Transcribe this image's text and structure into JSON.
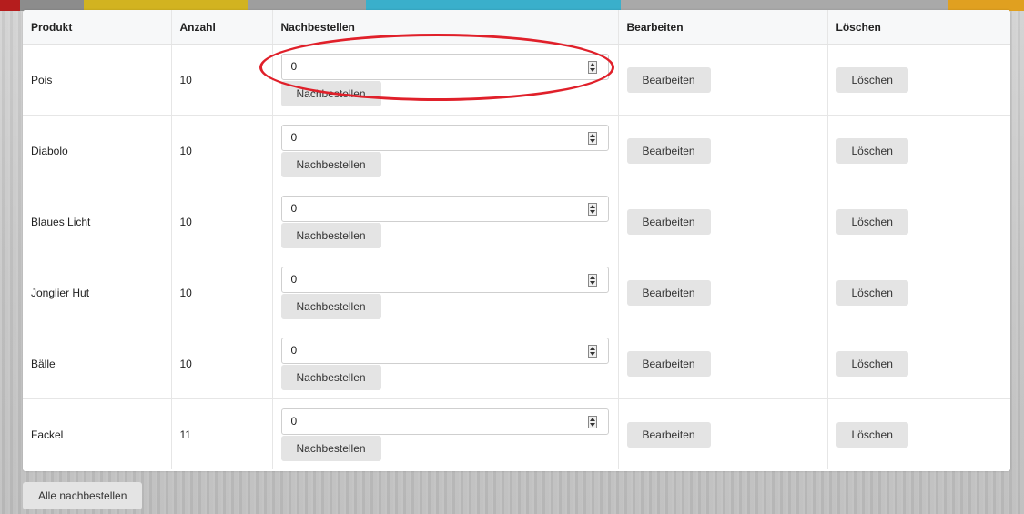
{
  "colors": {
    "strip": [
      "#b51d1d",
      "#c9a51a",
      "#d8c623",
      "#2fa8c4",
      "#38b2cf",
      "#8a8a8a",
      "#9a9a9a",
      "#e0a020"
    ],
    "annotation": "#e0202a"
  },
  "table": {
    "headers": [
      "Produkt",
      "Anzahl",
      "Nachbestellen",
      "Bearbeiten",
      "Löschen"
    ],
    "rows": [
      {
        "produkt": "Pois",
        "anzahl": "10",
        "value": "0",
        "reorder": "Nachbestellen",
        "edit": "Bearbeiten",
        "delete": "Löschen"
      },
      {
        "produkt": "Diabolo",
        "anzahl": "10",
        "value": "0",
        "reorder": "Nachbestellen",
        "edit": "Bearbeiten",
        "delete": "Löschen"
      },
      {
        "produkt": "Blaues Licht",
        "anzahl": "10",
        "value": "0",
        "reorder": "Nachbestellen",
        "edit": "Bearbeiten",
        "delete": "Löschen"
      },
      {
        "produkt": "Jonglier Hut",
        "anzahl": "10",
        "value": "0",
        "reorder": "Nachbestellen",
        "edit": "Bearbeiten",
        "delete": "Löschen"
      },
      {
        "produkt": "Bälle",
        "anzahl": "10",
        "value": "0",
        "reorder": "Nachbestellen",
        "edit": "Bearbeiten",
        "delete": "Löschen"
      },
      {
        "produkt": "Fackel",
        "anzahl": "11",
        "value": "0",
        "reorder": "Nachbestellen",
        "edit": "Bearbeiten",
        "delete": "Löschen"
      }
    ]
  },
  "footer": {
    "reorder_all_label": "Alle nachbestellen"
  }
}
